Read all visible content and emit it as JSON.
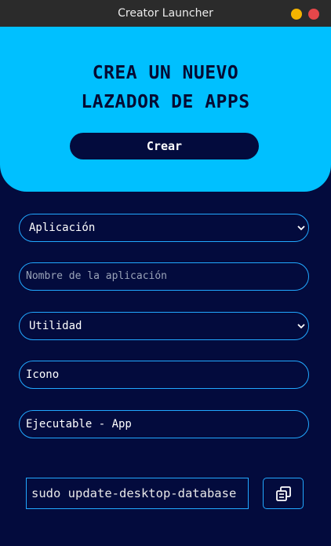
{
  "window": {
    "title": "Creator Launcher"
  },
  "hero": {
    "heading_line1": "CREA UN NUEVO",
    "heading_line2": "LAZADOR DE APPS",
    "create_label": "Crear"
  },
  "form": {
    "type_select": {
      "value": "Aplicación"
    },
    "name_input": {
      "placeholder": "Nombre de la aplicación",
      "value": ""
    },
    "category_select": {
      "value": "Utilidad"
    },
    "icon_input": {
      "value": "Icono"
    },
    "exec_input": {
      "value": "Ejecutable - App"
    }
  },
  "command": {
    "text": "sudo update-desktop-database"
  },
  "icons": {
    "chevron": "chevron-down-icon",
    "copy": "copy-icon"
  },
  "colors": {
    "accent": "#00c0ff",
    "background": "#030b3d",
    "border": "#21a8ff"
  }
}
